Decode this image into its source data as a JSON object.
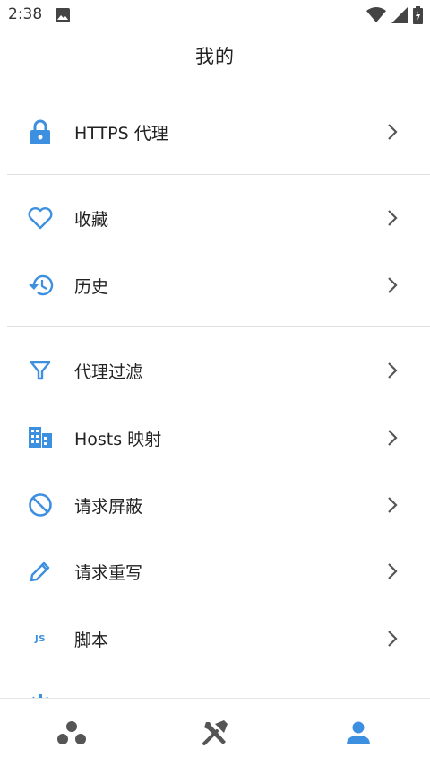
{
  "status_bar": {
    "time": "2:38"
  },
  "header": {
    "title": "我的"
  },
  "menu": {
    "https_proxy": "HTTPS 代理",
    "favorites": "收藏",
    "history": "历史",
    "proxy_filter": "代理过滤",
    "hosts_mapping": "Hosts 映射",
    "request_block": "请求屏蔽",
    "request_rewrite": "请求重写",
    "script": "脚本",
    "script_icon_text": "JS"
  },
  "colors": {
    "accent": "#3d8fe0",
    "text": "#222222",
    "icon_gray": "#555555"
  },
  "icons": [
    "lock-icon",
    "heart-icon",
    "history-icon",
    "filter-icon",
    "building-icon",
    "block-icon",
    "pencil-icon",
    "js-icon",
    "gear-icon",
    "chevron-right-icon",
    "nodes-icon",
    "tools-icon",
    "person-icon"
  ]
}
